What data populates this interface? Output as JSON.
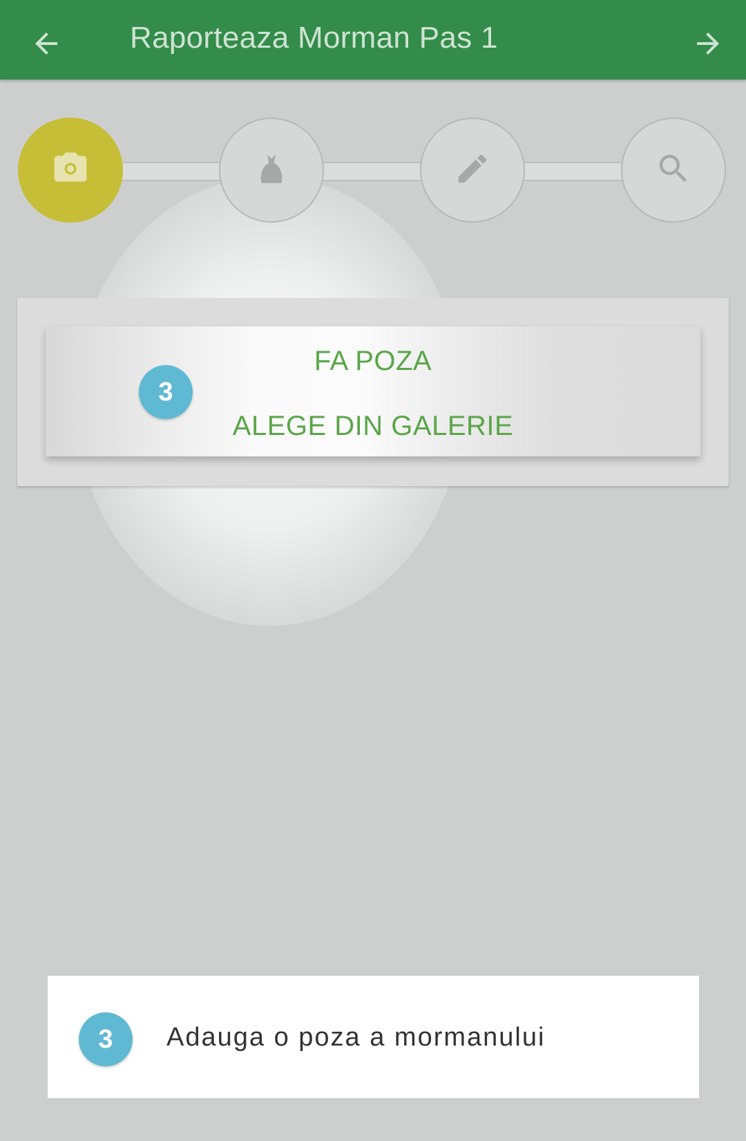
{
  "appbar": {
    "title": "Raporteaza Morman Pas 1",
    "background": "#338c49",
    "back_icon": "arrow-left-icon",
    "forward_icon": "arrow-right-icon"
  },
  "stepper": {
    "active_color": "#c6be36",
    "steps": [
      {
        "icon": "camera-icon",
        "state": "active"
      },
      {
        "icon": "garbage-bag-icon",
        "state": "inactive"
      },
      {
        "icon": "pencil-icon",
        "state": "inactive"
      },
      {
        "icon": "search-icon",
        "state": "inactive"
      }
    ]
  },
  "photo_options": {
    "take_photo_label": "FA POZA",
    "choose_gallery_label": "ALEGE DIN GALERIE",
    "label_color": "#5aa648"
  },
  "tutorial": {
    "step_number": "3",
    "badge_color": "#5fb9d3",
    "tip_text": "Adauga o poza a mormanului"
  }
}
